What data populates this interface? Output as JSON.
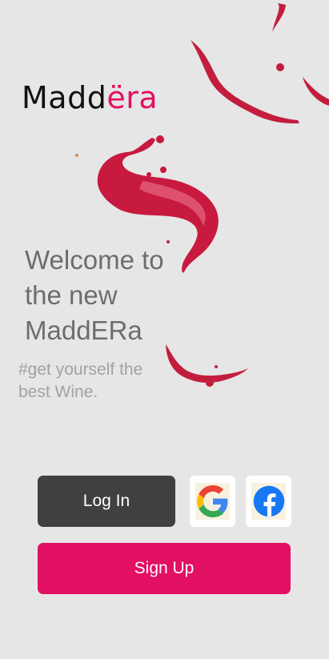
{
  "brand": {
    "name_dark": "Madd",
    "name_accent": "ëra",
    "accent_color": "#e21062"
  },
  "hero": {
    "welcome_lines": [
      "Welcome to",
      "the new",
      "MaddERa"
    ],
    "tagline_lines": [
      "#get yourself the",
      "best Wine."
    ]
  },
  "actions": {
    "login_label": "Log In",
    "signup_label": "Sign Up",
    "google_icon": "google-icon",
    "facebook_icon": "facebook-icon"
  },
  "colors": {
    "background": "#e6e6e6",
    "login_button": "#404040",
    "signup_button": "#e21062",
    "wine": "#c8193f"
  }
}
